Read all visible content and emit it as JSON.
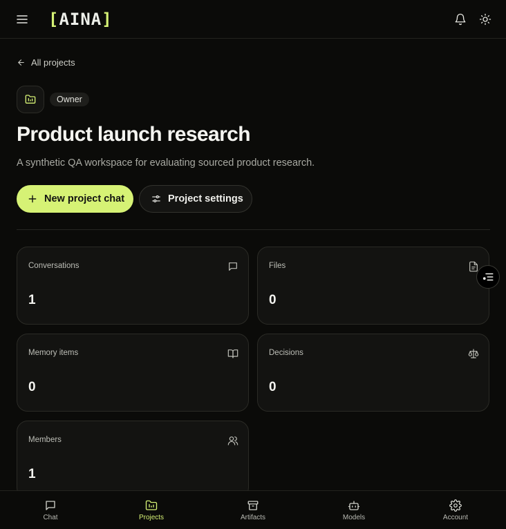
{
  "app": {
    "brand_open": "[",
    "brand_name": "AINA",
    "brand_close": "]"
  },
  "nav": {
    "back_label": "All projects"
  },
  "project": {
    "role": "Owner",
    "title": "Product launch research",
    "description": "A synthetic QA workspace for evaluating sourced product research."
  },
  "actions": {
    "new_chat_label": "New project chat",
    "settings_label": "Project settings"
  },
  "stats": {
    "conversations": {
      "label": "Conversations",
      "value": "1",
      "icon": "chat-bubble-icon"
    },
    "files": {
      "label": "Files",
      "value": "0",
      "icon": "file-icon"
    },
    "memory": {
      "label": "Memory items",
      "value": "0",
      "icon": "book-icon"
    },
    "decisions": {
      "label": "Decisions",
      "value": "0",
      "icon": "scale-icon"
    },
    "members": {
      "label": "Members",
      "value": "1",
      "icon": "users-icon"
    }
  },
  "bottom_nav": {
    "chat": "Chat",
    "projects": "Projects",
    "artifacts": "Artifacts",
    "models": "Models",
    "account": "Account",
    "active": "Projects"
  },
  "colors": {
    "accent": "#d6f275",
    "background": "#0b0b09",
    "card": "#131311",
    "text_muted": "#a9aaa3"
  }
}
